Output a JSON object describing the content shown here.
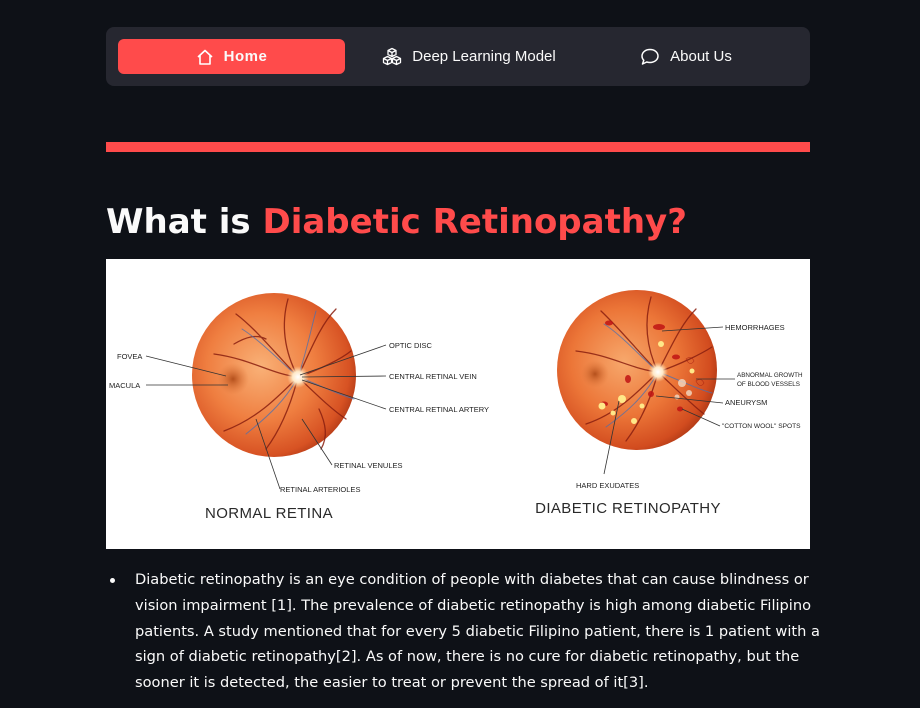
{
  "nav": {
    "items": [
      {
        "label": "Home",
        "icon": "house-icon",
        "active": true
      },
      {
        "label": "Deep Learning Model",
        "icon": "cubes-icon",
        "active": false
      },
      {
        "label": "About Us",
        "icon": "chat-bubble-icon",
        "active": false
      }
    ]
  },
  "colors": {
    "accent": "#ff4b4b",
    "background": "#0e1117",
    "nav_bg": "#262730"
  },
  "heading": {
    "prefix": "What is ",
    "highlight": "Diabetic Retinopathy?"
  },
  "figure": {
    "left_caption": "NORMAL RETINA",
    "right_caption": "DIABETIC RETINOPATHY",
    "left_labels": {
      "fovea": "FOVEA",
      "macula": "MACULA",
      "optic_disc": "OPTIC DISC",
      "central_retinal_vein": "CENTRAL RETINAL VEIN",
      "central_retinal_artery": "CENTRAL RETINAL ARTERY",
      "retinal_venules": "RETINAL VENULES",
      "retinal_arterioles": "RETINAL ARTERIOLES"
    },
    "right_labels": {
      "hemorrhages": "HEMORRHAGES",
      "abnormal_growth_1": "ABNORMAL GROWTH",
      "abnormal_growth_2": "OF BLOOD VESSELS",
      "aneurysm": "ANEURYSM",
      "cotton_wool": "\"COTTON WOOL\" SPOTS",
      "hard_exudates": "HARD EXUDATES"
    }
  },
  "paragraphs": [
    "Diabetic retinopathy is an eye condition of people with diabetes that can cause blindness or vision impairment [1]. The prevalence of diabetic retinopathy is high among diabetic Filipino patients. A study mentioned that for every 5 diabetic Filipino patient, there is 1 patient with a sign of diabetic retinopathy[2]. As of now, there is no cure for diabetic retinopathy, but the sooner it is detected, the easier to treat or prevent the spread of it[3]."
  ]
}
